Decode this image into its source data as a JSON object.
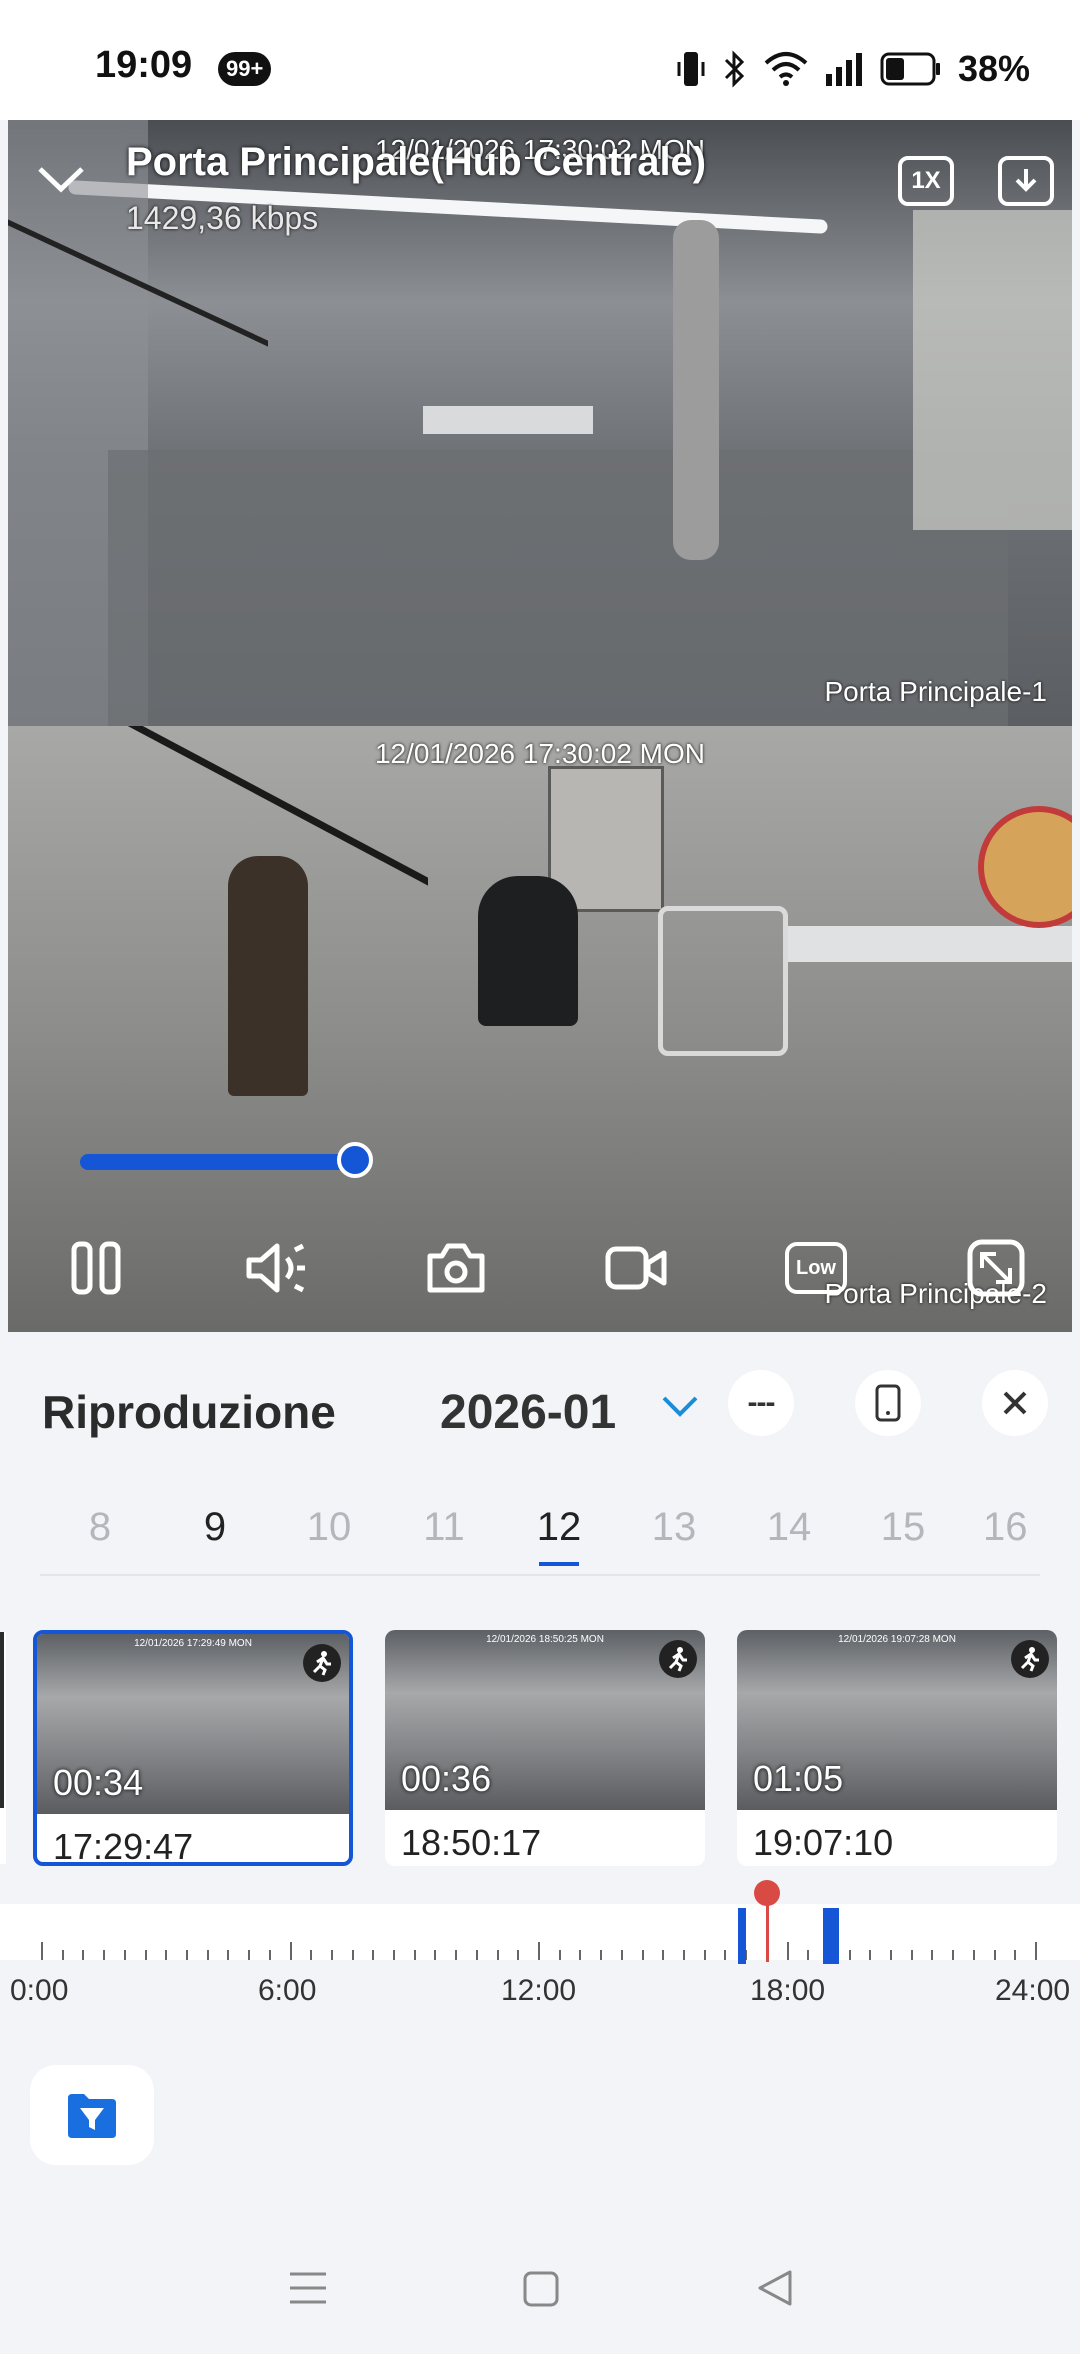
{
  "status_bar": {
    "time": "19:09",
    "notif_badge": "99+",
    "battery": "38%"
  },
  "player": {
    "title": "Porta Principale(Hub Centrale)",
    "bitrate": "1429,36 kbps",
    "speed": "1X",
    "progress": 0.72,
    "cameras": [
      {
        "timestamp": "12/01/2026 17:30:02 MON",
        "name": "Porta Principale-1"
      },
      {
        "timestamp": "12/01/2026 17:30:02 MON",
        "name": "Porta Principale-2"
      }
    ],
    "quality": "Low"
  },
  "playback": {
    "title": "Riproduzione",
    "month": "2026-01",
    "days": [
      "8",
      "9",
      "10",
      "11",
      "12",
      "13",
      "14",
      "15",
      "16"
    ],
    "selected_day": "12",
    "clips": [
      {
        "duration": "00:34",
        "time": "17:29:47",
        "stamp": "12/01/2026 17:29:49 MON",
        "selected": true
      },
      {
        "duration": "00:36",
        "time": "18:50:17",
        "stamp": "12/01/2026 18:50:25 MON",
        "selected": false
      },
      {
        "duration": "01:05",
        "time": "19:07:10",
        "stamp": "12/01/2026 19:07:28 MON",
        "selected": false
      }
    ]
  },
  "timeline": {
    "labels": [
      "0:00",
      "6:00",
      "12:00",
      "18:00",
      "24:00"
    ],
    "events": [
      16.9,
      18.95,
      19.15
    ],
    "cursor": 17.5
  },
  "colors": {
    "accent": "#1456d6",
    "cursor": "#d94a45"
  }
}
